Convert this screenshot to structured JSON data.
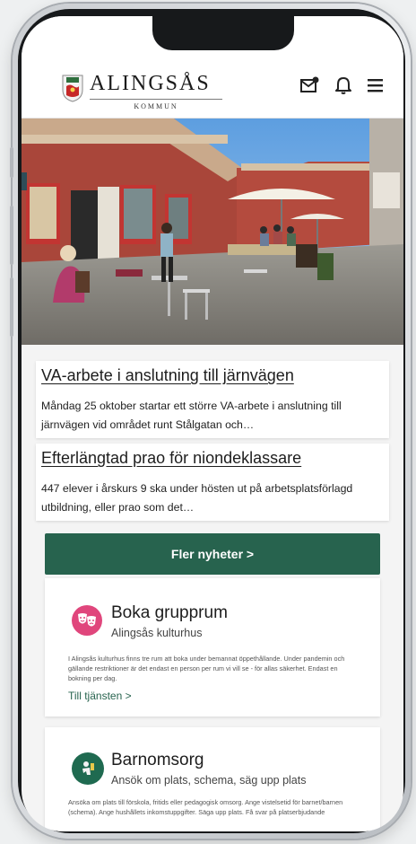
{
  "header": {
    "logo": {
      "name": "ALINGSÅS",
      "subtitle": "KOMMUN"
    },
    "icons": [
      "mail-icon",
      "bell-icon",
      "menu-icon"
    ]
  },
  "news": [
    {
      "title": "VA-arbete i anslutning till järnvägen",
      "body": "Måndag 25 oktober startar ett större VA-arbete i anslutning till järnvägen vid området runt Stålgatan och…"
    },
    {
      "title": "Efterlängtad prao för niondeklassare",
      "body": "447 elever i årskurs 9 ska under hösten ut på arbetsplatsförlagd utbildning, eller prao som det…"
    }
  ],
  "more_news_label": "Fler nyheter >",
  "services": [
    {
      "title": "Boka grupprum",
      "subtitle": "Alingsås kulturhus",
      "description": "I Alingsås kulturhus finns tre rum att boka under bemannat öppethållande. Under pandemin och gällande restriktioner är det endast en person per rum vi vill se - för allas säkerhet. Endast en bokning per dag.",
      "link": "Till tjänsten >",
      "icon": "theater-masks-icon",
      "icon_color": "#e0467c"
    },
    {
      "title": "Barnomsorg",
      "subtitle": "Ansök om plats, schema, säg upp plats",
      "description": "Ansöka om plats till förskola, fritids eller pedagogisk omsorg. Ange vistelsetid för barnet/barnen (schema). Ange hushållets inkomstuppgifter. Säga upp plats. Få svar på platserbjudande",
      "icon": "child-icon",
      "icon_color": "#1f6a50"
    }
  ],
  "colors": {
    "accent": "#27634e",
    "pink": "#e0467c",
    "card": "#ffffff",
    "background": "#f4f4f4"
  }
}
